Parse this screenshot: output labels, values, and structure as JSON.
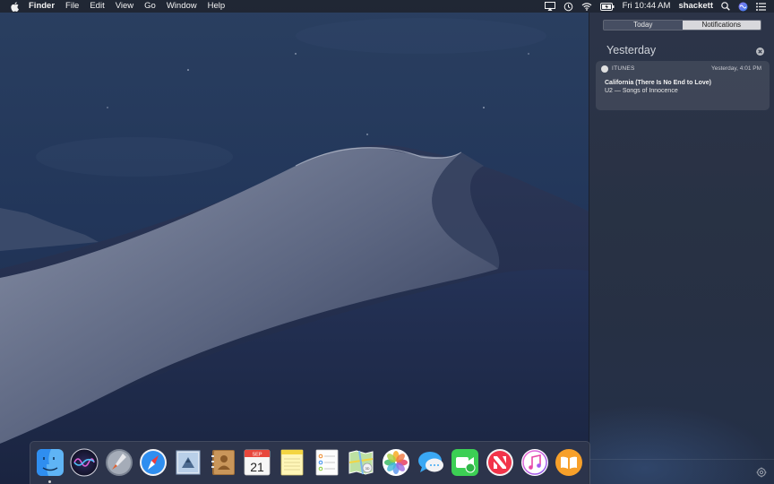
{
  "menubar": {
    "app_name": "Finder",
    "menus": [
      "File",
      "Edit",
      "View",
      "Go",
      "Window",
      "Help"
    ],
    "clock": "Fri 10:44 AM",
    "user": "shackett",
    "status_icons": [
      "airplay-icon",
      "time-machine-icon",
      "wifi-icon",
      "battery-icon",
      "spotlight-search-icon",
      "siri-icon",
      "notification-center-icon"
    ]
  },
  "notification_center": {
    "tabs": {
      "today": "Today",
      "notifications": "Notifications"
    },
    "selected_tab": "Notifications",
    "section_title": "Yesterday",
    "notification": {
      "app_name": "ITUNES",
      "time": "Yesterday, 4:01 PM",
      "title": "California (There Is No End to Love)",
      "subtitle": "U2 — Songs of Innocence"
    }
  },
  "dock": {
    "apps": [
      "finder-icon",
      "siri-icon",
      "launchpad-icon",
      "safari-icon",
      "mail-icon",
      "contacts-icon",
      "calendar-icon",
      "notes-icon",
      "reminders-icon",
      "maps-icon",
      "photos-icon",
      "messages-icon",
      "facetime-icon",
      "news-icon",
      "itunes-icon",
      "books-icon"
    ],
    "calendar": {
      "month": "SEP",
      "day": "21"
    }
  },
  "colors": {
    "menubar_bg": "#1e2028",
    "nc_bg": "#2c3446",
    "wallpaper_sky": "#263a5c"
  }
}
